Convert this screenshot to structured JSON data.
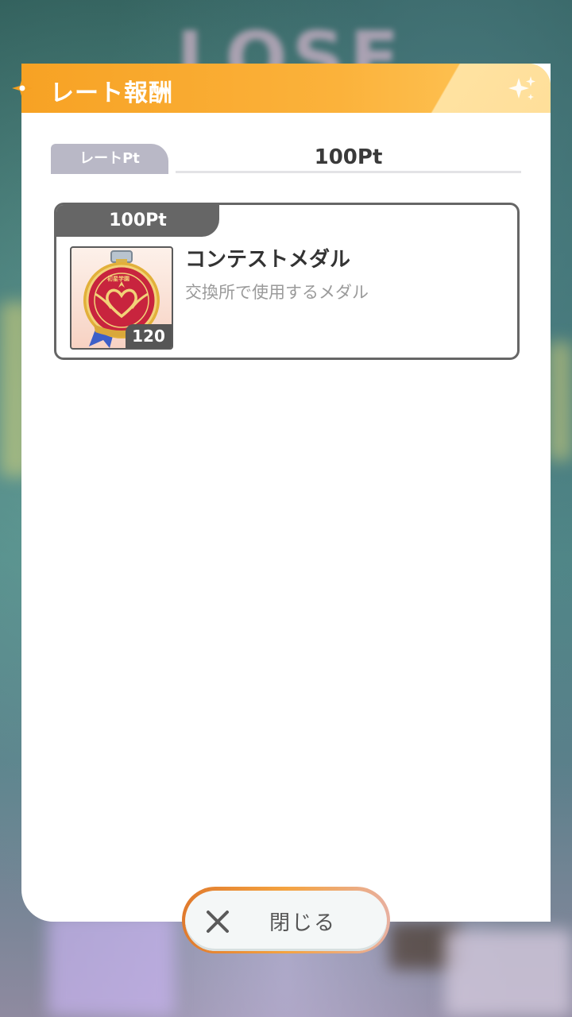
{
  "background": {
    "word": "LOSE"
  },
  "dialog": {
    "title": "レート報酬",
    "rate": {
      "label": "レートPt",
      "value": "100Pt"
    },
    "rewards": [
      {
        "threshold": "100Pt",
        "item_name": "コンテストメダル",
        "item_description": "交換所で使用するメダル",
        "count": "120",
        "icon": "contest-medal-icon",
        "medal_text": "初星学園"
      }
    ],
    "close_label": "閉じる"
  },
  "colors": {
    "header_orange": "#f7a224",
    "label_gray": "#b9b8c6",
    "card_border": "#666666",
    "medal_red": "#c8243e",
    "medal_gold": "#e2b03a"
  }
}
